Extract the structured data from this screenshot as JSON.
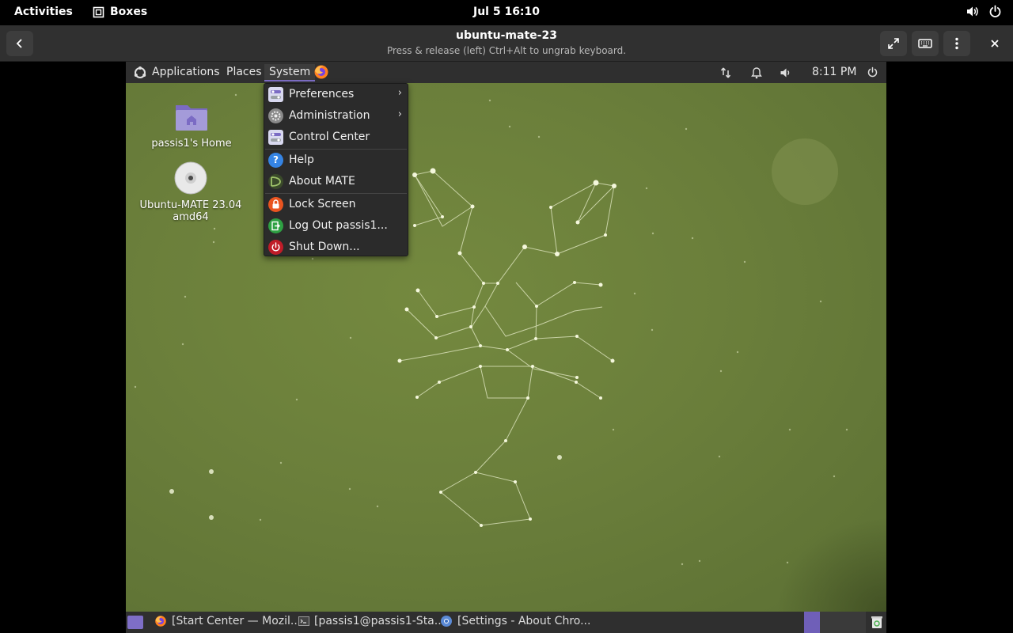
{
  "gnome_bar": {
    "activities": "Activities",
    "app_name": "Boxes",
    "clock": "Jul 5  16:10"
  },
  "boxes_header": {
    "title": "ubuntu-mate-23",
    "subtitle": "Press & release (left) Ctrl+Alt to ungrab keyboard."
  },
  "mate_panel": {
    "applications": "Applications",
    "places": "Places",
    "system": "System",
    "time": "8:11 PM"
  },
  "system_menu": {
    "items": [
      {
        "label": "Preferences",
        "icon": "preferences-icon",
        "submenu": true
      },
      {
        "label": "Administration",
        "icon": "administration-icon",
        "submenu": true
      },
      {
        "label": "Control Center",
        "icon": "control-center-icon",
        "submenu": false
      },
      {
        "label": "Help",
        "icon": "help-icon",
        "submenu": false
      },
      {
        "label": "About MATE",
        "icon": "about-mate-icon",
        "submenu": false
      },
      {
        "label": "Lock Screen",
        "icon": "lock-screen-icon",
        "submenu": false
      },
      {
        "label": "Log Out passis1...",
        "icon": "log-out-icon",
        "submenu": false
      },
      {
        "label": "Shut Down...",
        "icon": "shut-down-icon",
        "submenu": false
      }
    ]
  },
  "desktop_icons": [
    {
      "label": "passis1's Home",
      "icon": "home-folder-icon"
    },
    {
      "label": "Ubuntu-MATE 23.04 amd64",
      "icon": "disc-icon"
    }
  ],
  "taskbar": {
    "tasks": [
      {
        "label": "[Start Center — Mozil...",
        "icon": "firefox-icon"
      },
      {
        "label": "[passis1@passis1-Sta...",
        "icon": "terminal-icon"
      },
      {
        "label": "[Settings - About Chro...",
        "icon": "chromium-icon"
      }
    ]
  },
  "colors": {
    "desktop_green": "#6b7f3b",
    "panel": "#2f2f2f",
    "accent_purple": "#7e6ec7"
  }
}
